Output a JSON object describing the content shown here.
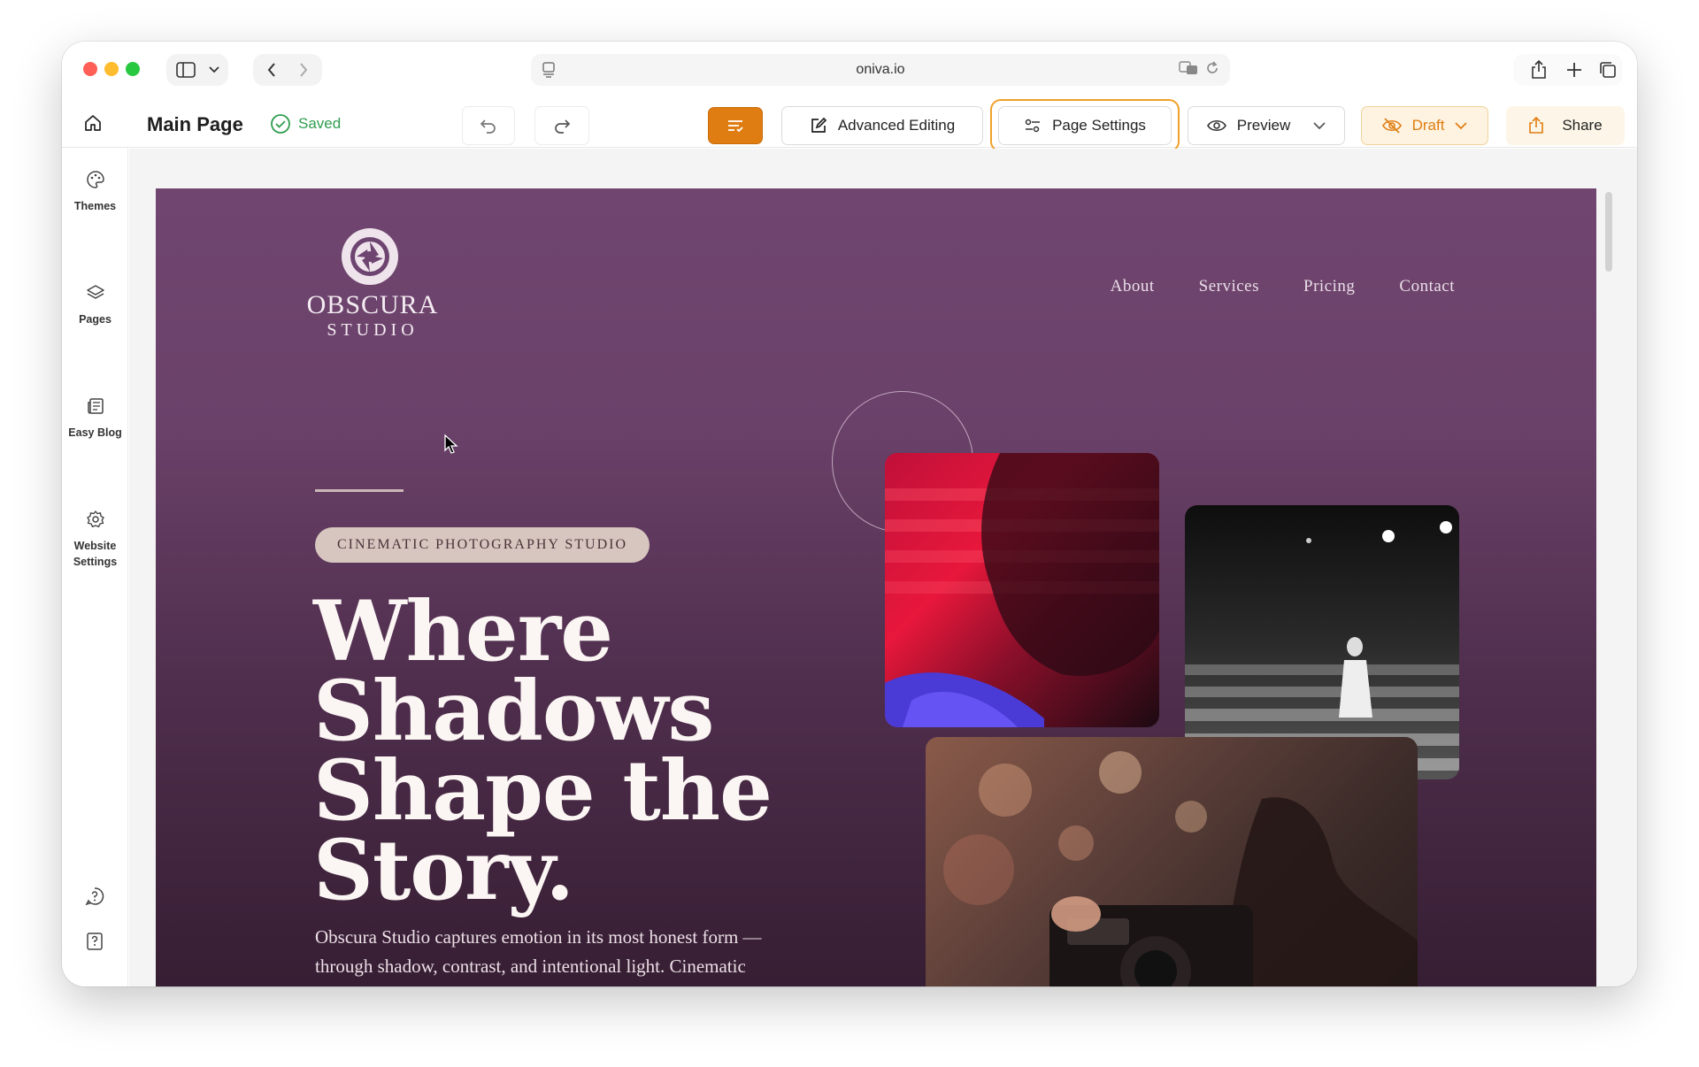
{
  "browser": {
    "url": "oniva.io"
  },
  "toolbar": {
    "page_name": "Main Page",
    "status": "Saved",
    "advanced_editing": "Advanced Editing",
    "page_settings": "Page Settings",
    "preview": "Preview",
    "draft": "Draft",
    "share": "Share"
  },
  "sidebar": {
    "items": [
      {
        "label": "Themes",
        "icon": "palette-icon"
      },
      {
        "label": "Pages",
        "icon": "layers-icon"
      },
      {
        "label": "Easy Blog",
        "icon": "blog-icon"
      },
      {
        "label": "Website Settings",
        "icon": "gear-icon"
      }
    ]
  },
  "site": {
    "logo_name": "OBSCURA",
    "logo_sub": "STUDIO",
    "nav": [
      "About",
      "Services",
      "Pricing",
      "Contact"
    ],
    "badge": "CINEMATIC PHOTOGRAPHY STUDIO",
    "headline": [
      "Where",
      "Shadows",
      "Shape the",
      "Story."
    ],
    "paragraph": "Obscura Studio captures emotion in its most honest form — through shadow, contrast, and intentional light. Cinematic photography with depth."
  },
  "colors": {
    "accent_orange": "#e07d12",
    "saved_green": "#2f9e4f",
    "draft_bg": "#fdf3e0",
    "hero_purple": "#704670"
  }
}
